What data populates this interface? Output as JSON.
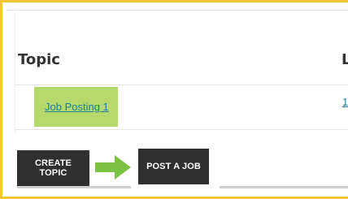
{
  "table": {
    "columns": [
      "Topic",
      "L"
    ],
    "rows": [
      {
        "topic": "Job Posting 1",
        "next": "1"
      }
    ]
  },
  "buttons": {
    "create_topic": "CREATE TOPIC",
    "post_a_job": "POST A JOB"
  },
  "icons": {
    "arrow": "right-arrow-icon"
  },
  "colors": {
    "frame_border": "#f2c531",
    "highlight": "#b5d96b",
    "link": "#1f7f9a",
    "button_bg": "#2f2f2f",
    "arrow": "#7cc242"
  }
}
